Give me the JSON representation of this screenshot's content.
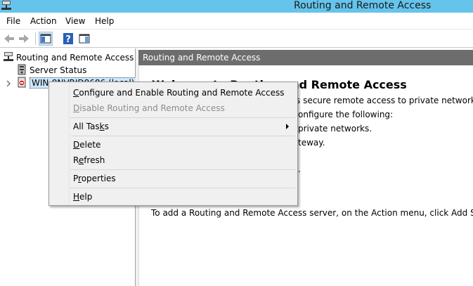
{
  "window": {
    "title": "Routing and Remote Access"
  },
  "menu": [
    {
      "label": "File"
    },
    {
      "label": "Action"
    },
    {
      "label": "View"
    },
    {
      "label": "Help"
    }
  ],
  "toolbar": {
    "back_icon": "back-arrow-icon",
    "forward_icon": "forward-arrow-icon",
    "show_hide_tree_icon": "console-tree-icon",
    "help_icon": "help-icon",
    "action_pane_icon": "action-pane-icon"
  },
  "tree": {
    "root": "Routing and Remote Access",
    "server_status": "Server Status",
    "server_prefix": "WIN-",
    "server_suffix": "8NVRJD8686 (local)"
  },
  "right_pane": {
    "header": "Routing and Remote Access",
    "welcome_visible": "Welcome to Routing and Remote Access",
    "line1_visible": "s secure remote access to private networks.",
    "line2_visible": "onfigure the following:",
    "line3_visible": "private networks.",
    "line4_visible": "teway.",
    "line5_visible": ".",
    "bottom_line": "To add a Routing and Remote Access server, on the Action menu, click Add Serv"
  },
  "context_menu": {
    "configure": {
      "accel": "C",
      "rest": "onfigure and Enable Routing and Remote Access"
    },
    "disable": {
      "accel": "D",
      "rest": "isable Routing and Remote Access"
    },
    "all_tasks": {
      "pre": "All Tas",
      "accel": "k",
      "rest": "s"
    },
    "delete": {
      "accel": "D",
      "rest": "elete"
    },
    "refresh": {
      "pre": "R",
      "accel": "e",
      "rest": "fresh"
    },
    "properties": {
      "pre": "P",
      "accel": "r",
      "rest": "operties"
    },
    "help": {
      "accel": "H",
      "rest": "elp"
    }
  },
  "colors": {
    "titlebar": "#65c4ec",
    "pane_header": "#6d6d6d",
    "menu_bg": "#f0f0f0",
    "selection": "#cce8ff"
  }
}
